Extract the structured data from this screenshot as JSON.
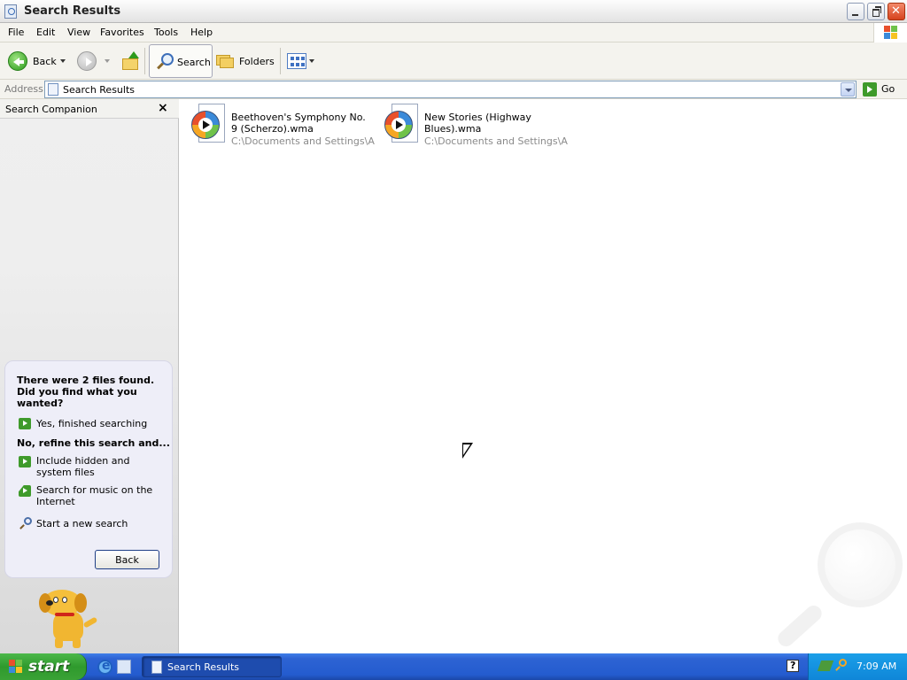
{
  "window": {
    "title": "Search Results"
  },
  "menu": [
    "File",
    "Edit",
    "View",
    "Favorites",
    "Tools",
    "Help"
  ],
  "toolbar": {
    "back_label": "Back",
    "search_label": "Search",
    "folders_label": "Folders"
  },
  "address": {
    "label": "Address",
    "value": "Search Results",
    "go_label": "Go"
  },
  "sidepane": {
    "title": "Search Companion",
    "headline": "There were 2 files found. Did you find what you wanted?",
    "option_finished": "Yes, finished searching",
    "refine_heading": "No, refine this search and...",
    "option_hidden": "Include hidden and system files",
    "option_music": "Search for music on the Internet",
    "option_new": "Start a new search",
    "back_button": "Back"
  },
  "files": [
    {
      "name": "Beethoven's Symphony No. 9 (Scherzo).wma",
      "path": "C:\\Documents and Settings\\All..."
    },
    {
      "name": "New Stories (Highway Blues).wma",
      "path": "C:\\Documents and Settings\\All..."
    }
  ],
  "taskbar": {
    "start_label": "start",
    "task_label": "Search Results",
    "clock": "7:09 AM"
  }
}
